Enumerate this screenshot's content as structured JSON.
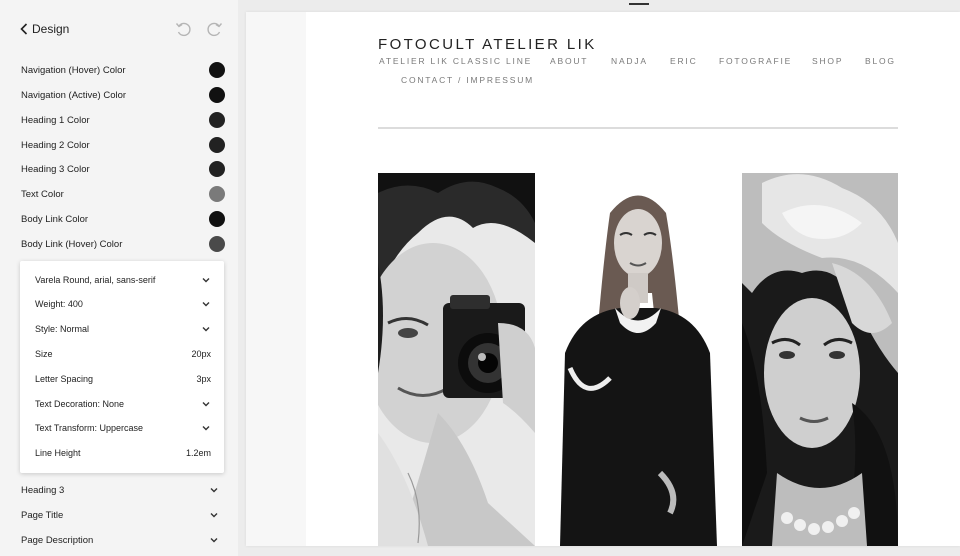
{
  "panel": {
    "back_label": "Design",
    "icons": {
      "back": "chevron-left-icon",
      "undo": "undo-icon",
      "redo": "redo-icon"
    },
    "color_settings": [
      {
        "label": "Navigation (Hover) Color",
        "color": "#111111"
      },
      {
        "label": "Navigation (Active) Color",
        "color": "#111111"
      },
      {
        "label": "Heading 1 Color",
        "color": "#222222"
      },
      {
        "label": "Heading 2 Color",
        "color": "#222222"
      },
      {
        "label": "Heading 3 Color",
        "color": "#222222"
      },
      {
        "label": "Text Color",
        "color": "#7a7a7a"
      },
      {
        "label": "Body Link Color",
        "color": "#111111"
      },
      {
        "label": "Body Link (Hover) Color",
        "color": "#4a4a4a"
      }
    ],
    "font_popover": {
      "font_family": "Varela Round, arial, sans-serif",
      "weight": "Weight: 400",
      "style": "Style: Normal",
      "size_label": "Size",
      "size_value": "20px",
      "letter_spacing_label": "Letter Spacing",
      "letter_spacing_value": "3px",
      "text_decoration": "Text Decoration: None",
      "text_transform": "Text Transform: Uppercase",
      "line_height_label": "Line Height",
      "line_height_value": "1.2em"
    },
    "accordion": [
      {
        "label": "Heading 3"
      },
      {
        "label": "Page Title"
      },
      {
        "label": "Page Description"
      }
    ]
  },
  "preview": {
    "site_title": "FOTOCULT ATELIER LIK",
    "nav": [
      "ATELIER LIK CLASSIC LINE",
      "ABOUT",
      "NADJA",
      "ERIC",
      "FOTOGRAFIE",
      "SHOP",
      "BLOG",
      "CONTACT / IMPRESSUM"
    ],
    "gallery": [
      {
        "subject": "woman with camera"
      },
      {
        "subject": "woman in dark dress"
      },
      {
        "subject": "woman with flower headpiece"
      }
    ]
  }
}
